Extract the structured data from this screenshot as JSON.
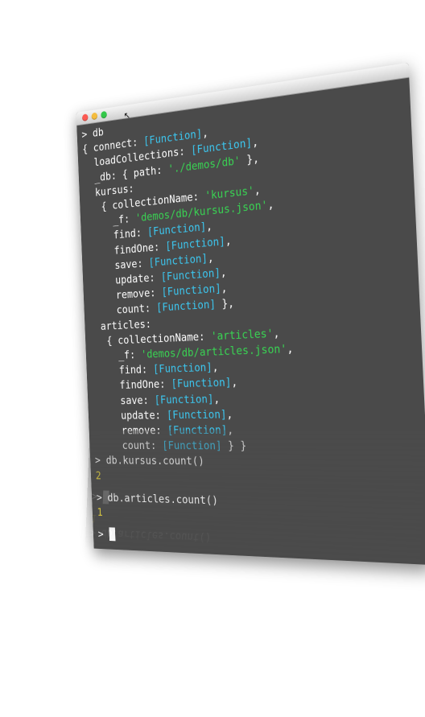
{
  "window": {
    "traffic_lights": [
      "close",
      "minimize",
      "zoom"
    ]
  },
  "terminal": {
    "lines": [
      [
        {
          "t": "> db",
          "c": "w"
        }
      ],
      [
        {
          "t": "{ connect: ",
          "c": "w"
        },
        {
          "t": "[Function]",
          "c": "fn"
        },
        {
          "t": ",",
          "c": "w"
        }
      ],
      [
        {
          "t": "  loadCollections: ",
          "c": "w"
        },
        {
          "t": "[Function]",
          "c": "fn"
        },
        {
          "t": ",",
          "c": "w"
        }
      ],
      [
        {
          "t": "  _db: { path: ",
          "c": "w"
        },
        {
          "t": "'./demos/db'",
          "c": "str"
        },
        {
          "t": " },",
          "c": "w"
        }
      ],
      [
        {
          "t": "  kursus:",
          "c": "w"
        }
      ],
      [
        {
          "t": "   { collectionName: ",
          "c": "w"
        },
        {
          "t": "'kursus'",
          "c": "str"
        },
        {
          "t": ",",
          "c": "w"
        }
      ],
      [
        {
          "t": "     _f: ",
          "c": "w"
        },
        {
          "t": "'demos/db/kursus.json'",
          "c": "str"
        },
        {
          "t": ",",
          "c": "w"
        }
      ],
      [
        {
          "t": "     find: ",
          "c": "w"
        },
        {
          "t": "[Function]",
          "c": "fn"
        },
        {
          "t": ",",
          "c": "w"
        }
      ],
      [
        {
          "t": "     findOne: ",
          "c": "w"
        },
        {
          "t": "[Function]",
          "c": "fn"
        },
        {
          "t": ",",
          "c": "w"
        }
      ],
      [
        {
          "t": "     save: ",
          "c": "w"
        },
        {
          "t": "[Function]",
          "c": "fn"
        },
        {
          "t": ",",
          "c": "w"
        }
      ],
      [
        {
          "t": "     update: ",
          "c": "w"
        },
        {
          "t": "[Function]",
          "c": "fn"
        },
        {
          "t": ",",
          "c": "w"
        }
      ],
      [
        {
          "t": "     remove: ",
          "c": "w"
        },
        {
          "t": "[Function]",
          "c": "fn"
        },
        {
          "t": ",",
          "c": "w"
        }
      ],
      [
        {
          "t": "     count: ",
          "c": "w"
        },
        {
          "t": "[Function]",
          "c": "fn"
        },
        {
          "t": " },",
          "c": "w"
        }
      ],
      [
        {
          "t": "  articles:",
          "c": "w"
        }
      ],
      [
        {
          "t": "   { collectionName: ",
          "c": "w"
        },
        {
          "t": "'articles'",
          "c": "str"
        },
        {
          "t": ",",
          "c": "w"
        }
      ],
      [
        {
          "t": "     _f: ",
          "c": "w"
        },
        {
          "t": "'demos/db/articles.json'",
          "c": "str"
        },
        {
          "t": ",",
          "c": "w"
        }
      ],
      [
        {
          "t": "     find: ",
          "c": "w"
        },
        {
          "t": "[Function]",
          "c": "fn"
        },
        {
          "t": ",",
          "c": "w"
        }
      ],
      [
        {
          "t": "     findOne: ",
          "c": "w"
        },
        {
          "t": "[Function]",
          "c": "fn"
        },
        {
          "t": ",",
          "c": "w"
        }
      ],
      [
        {
          "t": "     save: ",
          "c": "w"
        },
        {
          "t": "[Function]",
          "c": "fn"
        },
        {
          "t": ",",
          "c": "w"
        }
      ],
      [
        {
          "t": "     update: ",
          "c": "w"
        },
        {
          "t": "[Function]",
          "c": "fn"
        },
        {
          "t": ",",
          "c": "w"
        }
      ],
      [
        {
          "t": "     remove: ",
          "c": "w"
        },
        {
          "t": "[Function]",
          "c": "fn"
        },
        {
          "t": ",",
          "c": "w"
        }
      ],
      [
        {
          "t": "     count: ",
          "c": "w"
        },
        {
          "t": "[Function]",
          "c": "fn"
        },
        {
          "t": " } }",
          "c": "w"
        }
      ],
      [
        {
          "t": "> db.kursus.count()",
          "c": "w"
        }
      ],
      [
        {
          "t": "2",
          "c": "num"
        }
      ],
      [
        {
          "t": "",
          "c": "gap"
        }
      ],
      [
        {
          "t": "> db.articles.count()",
          "c": "w"
        }
      ],
      [
        {
          "t": "1",
          "c": "num"
        }
      ],
      [
        {
          "t": "",
          "c": "gap"
        }
      ]
    ],
    "prompt": "> ",
    "reflection_lines": [
      [
        {
          "t": "> db.articles.count()",
          "c": "w"
        }
      ],
      [
        {
          "t": "1",
          "c": "num"
        }
      ],
      [
        {
          "t": "",
          "c": "gap"
        }
      ]
    ]
  },
  "colors": {
    "background": "#4a4a4a",
    "text": "#ffffff",
    "function": "#3cc7f0",
    "string": "#39d353",
    "number": "#e6d33f"
  }
}
